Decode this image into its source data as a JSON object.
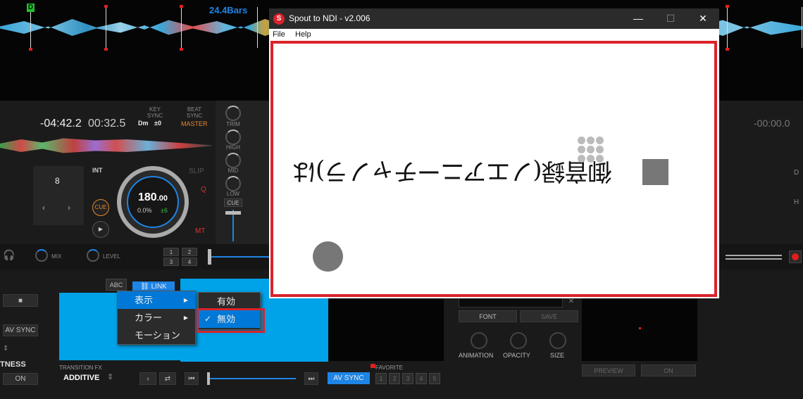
{
  "deck_top": {
    "cue_marker": "D",
    "bars": "24.4Bars"
  },
  "deck_left": {
    "time_remaining": "-04:42.2",
    "time_elapsed": "00:32.5",
    "key_sync_label": "KEY\nSYNC",
    "key_value": "Dm",
    "key_offset": "±0",
    "beat_sync_label": "BEAT\nSYNC",
    "master_label": "MASTER",
    "loop_value": "8",
    "int_label": "INT",
    "slip_label": "SLIP",
    "q_label": "Q",
    "mt_label": "MT",
    "cue_button": "CUE",
    "bpm": "180",
    "bpm_decimal": ".00",
    "pitch": "0.0%",
    "pitch_range": "±6"
  },
  "mixer": {
    "trim": "TRIM",
    "high": "HIGH",
    "mid": "MID",
    "low": "LOW",
    "cue": "CUE",
    "mix": "MIX",
    "level": "LEVEL"
  },
  "deck_right": {
    "time": "-00:00.0",
    "d_label": "D",
    "h_label": "H"
  },
  "fx": {
    "abc": "ABC",
    "link": "LINK",
    "av_sync_left": "AV SYNC",
    "tness": "TNESS",
    "on_left": "ON",
    "transition_label": "TRANSITION FX",
    "transition_value": "ADDITIVE",
    "av_sync_center": "AV SYNC",
    "favorite": "FAVORITE",
    "fav_slots": [
      "1",
      "2",
      "3",
      "4",
      "5"
    ],
    "pad_slots": [
      "1",
      "2",
      "3",
      "4"
    ],
    "font": "FONT",
    "save": "SAVE",
    "animation": "ANIMATION",
    "opacity": "OPACITY",
    "size": "SIZE",
    "preview": "PREVIEW",
    "on_right": "ON"
  },
  "context_menu": {
    "items": [
      "表示",
      "カラー",
      "モーション"
    ],
    "submenu": [
      "有効",
      "無効"
    ]
  },
  "window": {
    "title": "Spout to NDI - v2.006",
    "icon_letter": "S",
    "menu_file": "File",
    "menu_help": "Help",
    "minimize": "—",
    "maximize": "☐",
    "close": "✕",
    "canvas_text": "御音録(ノエアニーチャノラ)は"
  },
  "colors": {
    "accent_blue": "#1e84e6",
    "highlight_blue": "#0078d7",
    "panel_cyan": "#00a2e8",
    "annotation_red": "#d9232a"
  }
}
